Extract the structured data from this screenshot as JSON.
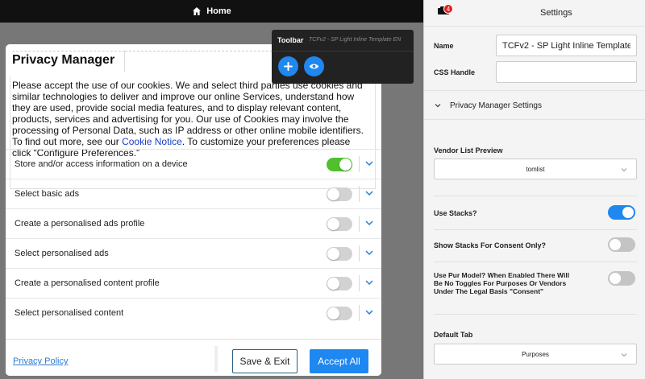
{
  "topbar": {
    "home_label": "Home"
  },
  "privacy_manager": {
    "title": "Privacy Manager",
    "description": "Please accept the use of our cookies. We and select third parties use cookies and similar technologies to deliver and improve our online Services, understand how they are used, provide social media features, and to display relevant content, products, services and advertising for you. Our use of Cookies may involve the processing of Personal Data, such as IP address or other online mobile identifiers. To find out more, see our ",
    "cookie_notice_link": "Cookie Notice",
    "description_end": ". To customize your preferences please click “Configure Preferences.”",
    "purposes": [
      {
        "label": "Store and/or access information on a device",
        "enabled": true
      },
      {
        "label": "Select basic ads",
        "enabled": false
      },
      {
        "label": "Create a personalised ads profile",
        "enabled": false
      },
      {
        "label": "Select personalised ads",
        "enabled": false
      },
      {
        "label": "Create a personalised content profile",
        "enabled": false
      },
      {
        "label": "Select personalised content",
        "enabled": false
      }
    ],
    "privacy_policy_link": "Privacy Policy",
    "save_exit_label": "Save & Exit",
    "accept_all_label": "Accept All"
  },
  "toolbar": {
    "title": "Toolbar",
    "subtitle": "TCFv2 - SP Light Inline Template EN",
    "add_icon": "plus-icon",
    "preview_icon": "eye-icon"
  },
  "settings": {
    "notification_count": "4",
    "title": "Settings",
    "name_label": "Name",
    "name_value": "TCFv2 - SP Light Inline Template",
    "css_label": "CSS Handle",
    "css_value": "",
    "section_label": "Privacy Manager Settings",
    "vendor_list_label": "Vendor List Preview",
    "vendor_list_value": "tomlist",
    "use_stacks_label": "Use Stacks?",
    "use_stacks": true,
    "show_stacks_label": "Show Stacks For Consent Only?",
    "show_stacks": false,
    "pur_model_label": "Use Pur Model? When Enabled There Will Be No Toggles For Purposes Or Vendors Under The Legal Basis \"Consent\"",
    "pur_model": false,
    "default_tab_label": "Default Tab",
    "default_tab_value": "Purposes"
  },
  "colors": {
    "accent_blue": "#1f87f0",
    "toggle_green": "#51c02c",
    "badge_red": "#e21b1b"
  }
}
